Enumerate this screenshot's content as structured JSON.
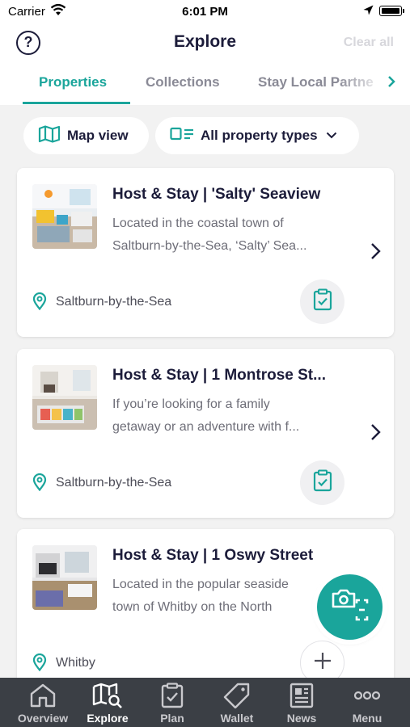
{
  "status_bar": {
    "carrier": "Carrier",
    "time": "6:01 PM"
  },
  "header": {
    "title": "Explore",
    "help": "?",
    "clear_all": "Clear all"
  },
  "tabs": [
    {
      "label": "Properties",
      "active": true
    },
    {
      "label": "Collections",
      "active": false
    },
    {
      "label": "Stay Local Partne",
      "active": false
    }
  ],
  "filters": {
    "map_view": "Map view",
    "property_types": "All property types"
  },
  "properties": [
    {
      "title": "Host & Stay | 'Salty' Seaview",
      "desc_line1": "Located in the coastal town of",
      "desc_line2": "Saltburn-by-the-Sea, ‘Salty’ Sea...",
      "location": "Saltburn-by-the-Sea",
      "action": "checklist-icon"
    },
    {
      "title": "Host & Stay | 1 Montrose St...",
      "desc_line1": "If you’re looking for a family",
      "desc_line2": "getaway or an adventure with f...",
      "location": "Saltburn-by-the-Sea",
      "action": "checklist-icon"
    },
    {
      "title": "Host & Stay | 1 Oswy Street",
      "desc_line1": "Located in the popular seaside",
      "desc_line2": "town of Whitby on the North",
      "location": "Whitby",
      "action": "plus-icon"
    }
  ],
  "tab_bar": [
    {
      "label": "Overview",
      "icon": "home-icon",
      "active": false
    },
    {
      "label": "Explore",
      "icon": "map-search-icon",
      "active": true
    },
    {
      "label": "Plan",
      "icon": "clipboard-icon",
      "active": false
    },
    {
      "label": "Wallet",
      "icon": "tag-icon",
      "active": false
    },
    {
      "label": "News",
      "icon": "newspaper-icon",
      "active": false
    },
    {
      "label": "Menu",
      "icon": "more-icon",
      "active": false
    }
  ],
  "colors": {
    "accent": "#1aa59b",
    "navy": "#1c1c3a",
    "tabbar": "#3b3f45"
  }
}
